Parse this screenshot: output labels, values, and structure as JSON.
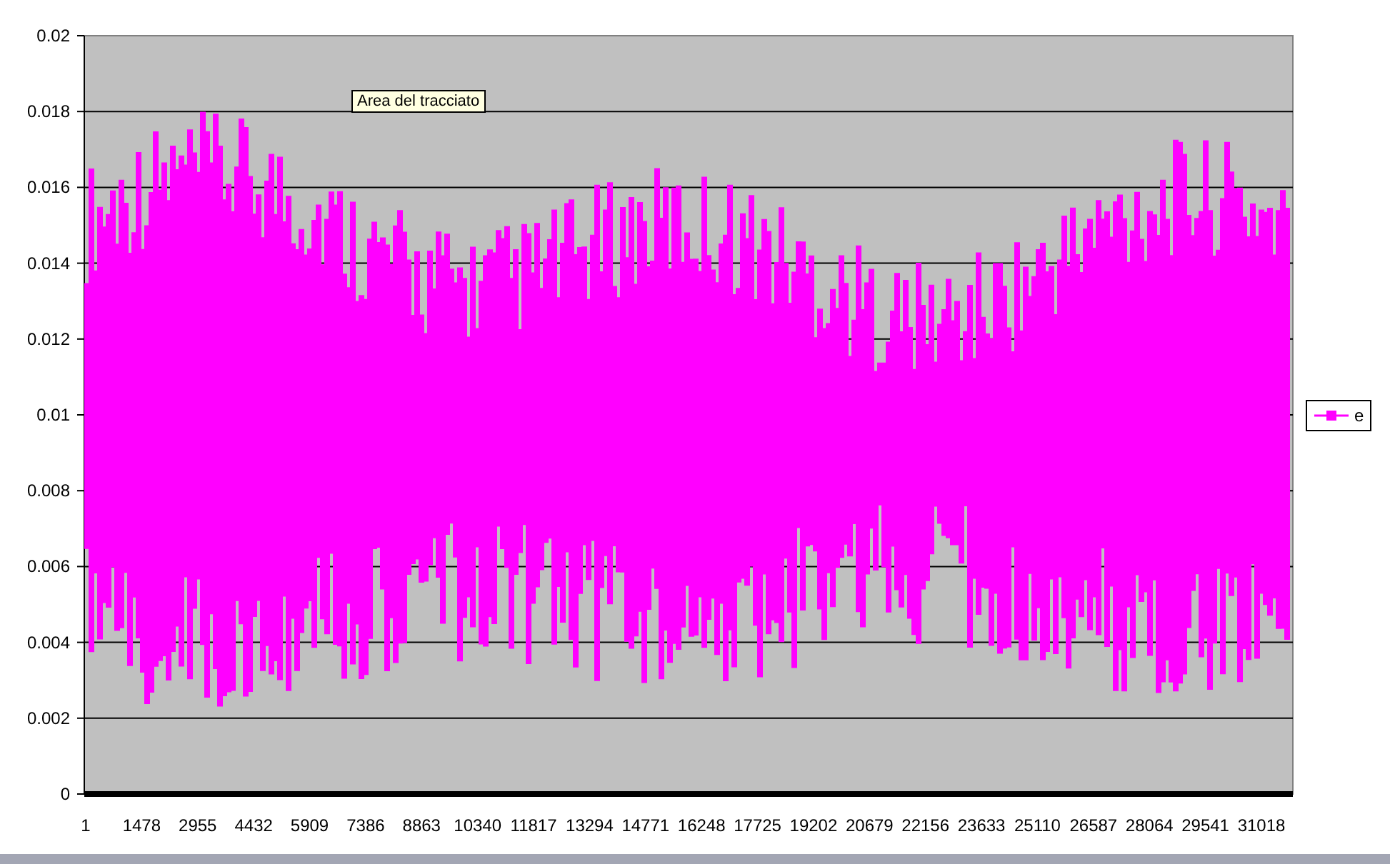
{
  "chart": {
    "y_ticks": [
      "0.02",
      "0.018",
      "0.016",
      "0.014",
      "0.012",
      "0.01",
      "0.008",
      "0.006",
      "0.004",
      "0.002",
      "0"
    ],
    "x_labels": [
      "1",
      "1478",
      "2955",
      "4432",
      "5909",
      "7386",
      "8863",
      "10340",
      "11817",
      "13294",
      "14771",
      "16248",
      "17725",
      "19202",
      "20679",
      "22156",
      "23633",
      "25110",
      "26587",
      "28064",
      "29541",
      "31018"
    ],
    "legend": [
      {
        "label": "e"
      }
    ],
    "tooltip": "Area del tracciato"
  }
}
